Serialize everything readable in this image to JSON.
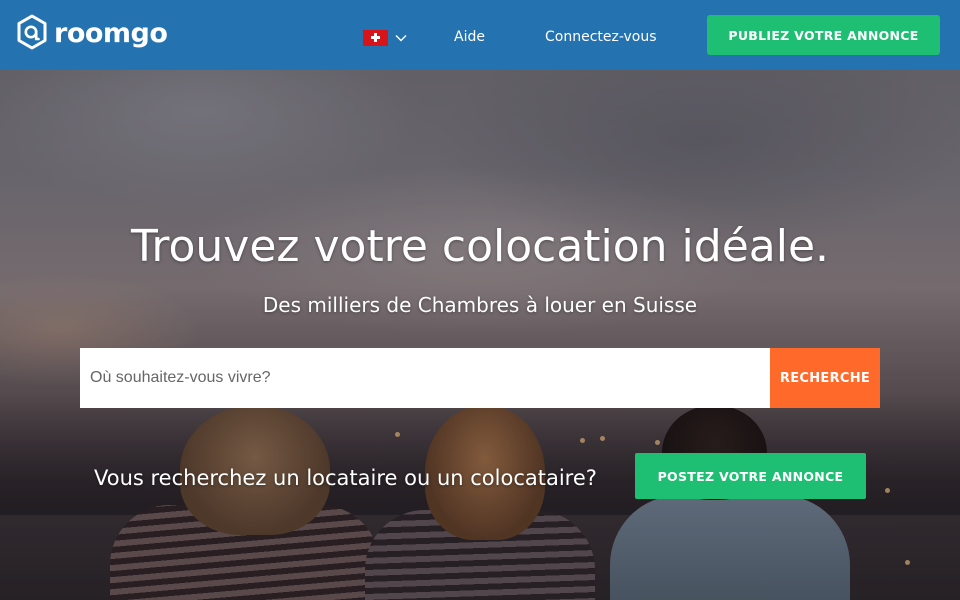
{
  "header": {
    "logo_text": "roomgo",
    "country_flag": "swiss-flag-icon",
    "nav_help": "Aide",
    "nav_login": "Connectez-vous",
    "publish_button": "PUBLIEZ VOTRE ANNONCE"
  },
  "hero": {
    "title": "Trouvez votre colocation idéale.",
    "subtitle": "Des milliers de Chambres à louer en Suisse",
    "search_placeholder": "Où souhaitez-vous vivre?",
    "search_value": "",
    "search_button": "RECHERCHE",
    "cta_text": "Vous recherchez un locataire ou un colocataire?",
    "cta_button": "POSTEZ VOTRE ANNONCE"
  },
  "colors": {
    "header_bg": "#2473b0",
    "primary_green": "#1fbf73",
    "search_orange": "#ff6a2b",
    "flag_red": "#d7141a"
  }
}
